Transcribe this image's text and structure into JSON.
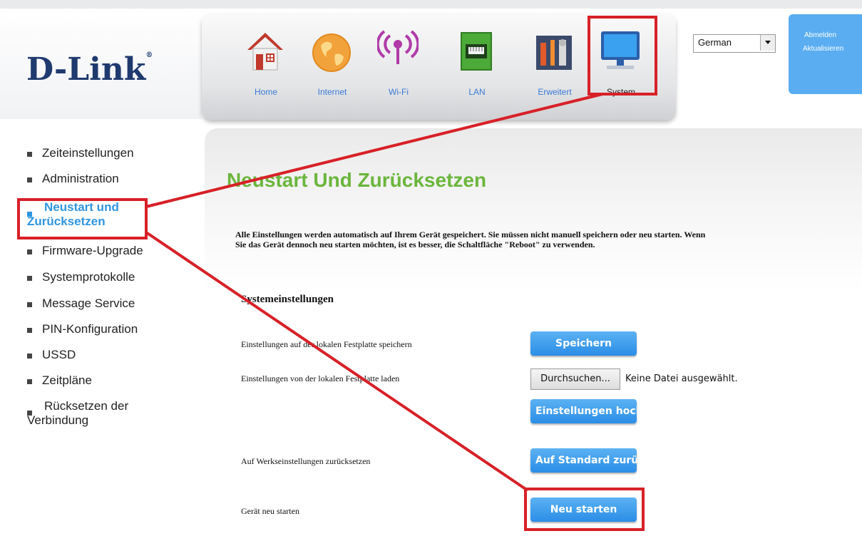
{
  "brand": {
    "logo_text": "D-Link",
    "reg_mark": "®"
  },
  "nav": {
    "items": [
      {
        "label": "Home",
        "icon": "house-icon"
      },
      {
        "label": "Internet",
        "icon": "globe-icon"
      },
      {
        "label": "Wi-Fi",
        "icon": "wifi-icon"
      },
      {
        "label": "LAN",
        "icon": "lan-port-icon"
      },
      {
        "label": "Erweitert",
        "icon": "tools-icon"
      },
      {
        "label": "System",
        "icon": "monitor-icon"
      }
    ],
    "selected": "System"
  },
  "language": {
    "selected": "German"
  },
  "user_links": {
    "logout": "Abmelden",
    "refresh": "Aktualisieren"
  },
  "sidebar": {
    "items": [
      {
        "label": "Zeiteinstellungen"
      },
      {
        "label": "Administration"
      },
      {
        "label": "Neustart und Zurücksetzen",
        "line1": "Neustart und",
        "line2": "Zurücksetzen",
        "active": true
      },
      {
        "label": "Firmware-Upgrade"
      },
      {
        "label": "Systemprotokolle"
      },
      {
        "label": "Message Service"
      },
      {
        "label": "PIN-Konfiguration"
      },
      {
        "label": "USSD"
      },
      {
        "label": "Zeitpläne"
      },
      {
        "label": "Rücksetzen der Verbindung",
        "line1": "Rücksetzen der",
        "line2": "Verbindung"
      }
    ]
  },
  "main": {
    "title": "Neustart Und Zurücksetzen",
    "description_line1": "Alle Einstellungen werden automatisch auf Ihrem Gerät gespeichert. Sie müssen nicht manuell speichern oder neu starten. Wenn",
    "description_line2": "Sie das Gerät dennoch neu starten möchten, ist es besser, die Schaltfläche \"Reboot\" zu verwenden.",
    "section_title": "Systemeinstellungen",
    "rows": {
      "save_label": "Einstellungen auf der lokalen Festplatte speichern",
      "save_button": "Speichern",
      "load_label": "Einstellungen von der lokalen Festplatte laden",
      "browse_button": "Durchsuchen...",
      "no_file": "Keine Datei ausgewählt.",
      "upload_button": "Einstellungen hochladen",
      "factory_label": "Auf Werkseinstellungen zurücksetzen",
      "factory_button": "Auf Standard zurücksetzen",
      "reboot_label": "Gerät neu starten",
      "reboot_button": "Neu starten"
    }
  },
  "colors": {
    "accent": "#2f95e0",
    "title_green": "#6bb63c",
    "highlight_red": "#d82027"
  }
}
